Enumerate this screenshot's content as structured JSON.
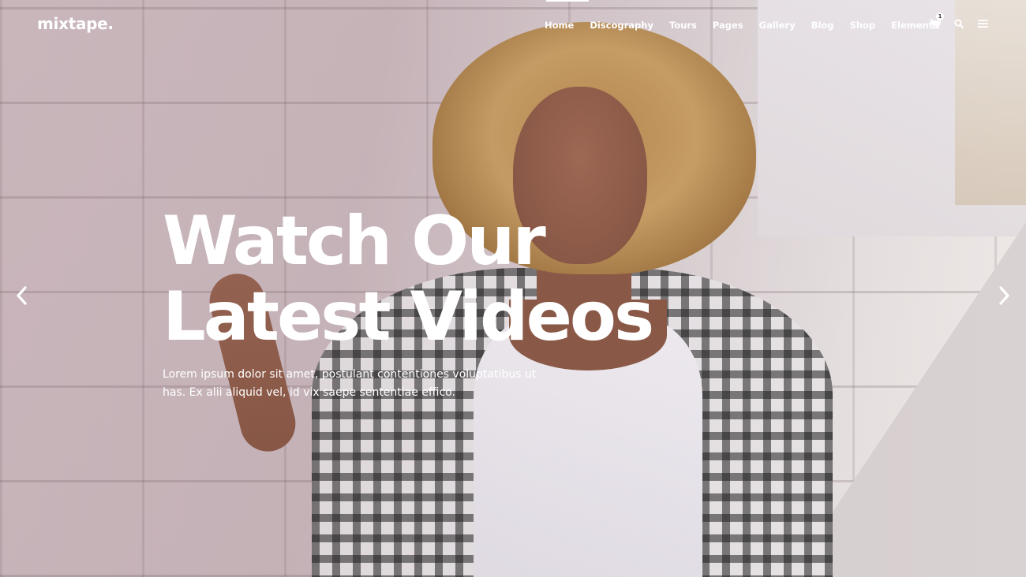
{
  "brand": {
    "logo_text": "mixtape."
  },
  "nav": {
    "items": [
      {
        "label": "Home",
        "active": true
      },
      {
        "label": "Discography",
        "active": false
      },
      {
        "label": "Tours",
        "active": false
      },
      {
        "label": "Pages",
        "active": false
      },
      {
        "label": "Gallery",
        "active": false
      },
      {
        "label": "Blog",
        "active": false
      },
      {
        "label": "Shop",
        "active": false
      },
      {
        "label": "Elements",
        "active": false
      }
    ],
    "icons": {
      "cart": "cart-icon",
      "search": "search-icon",
      "menu": "hamburger-menu-icon"
    },
    "cart_count": "1"
  },
  "hero": {
    "headline_line1": "Watch Our",
    "headline_line2": "Latest Videos",
    "subtext": "Lorem ipsum dolor sit amet, postulant contentiones voluptatibus ut has. Ex alii aliquid vel, id vix saepe sententiae effico.",
    "text_color": "#ffffff"
  },
  "slider": {
    "prev_icon": "chevron-left-icon",
    "next_icon": "chevron-right-icon"
  }
}
